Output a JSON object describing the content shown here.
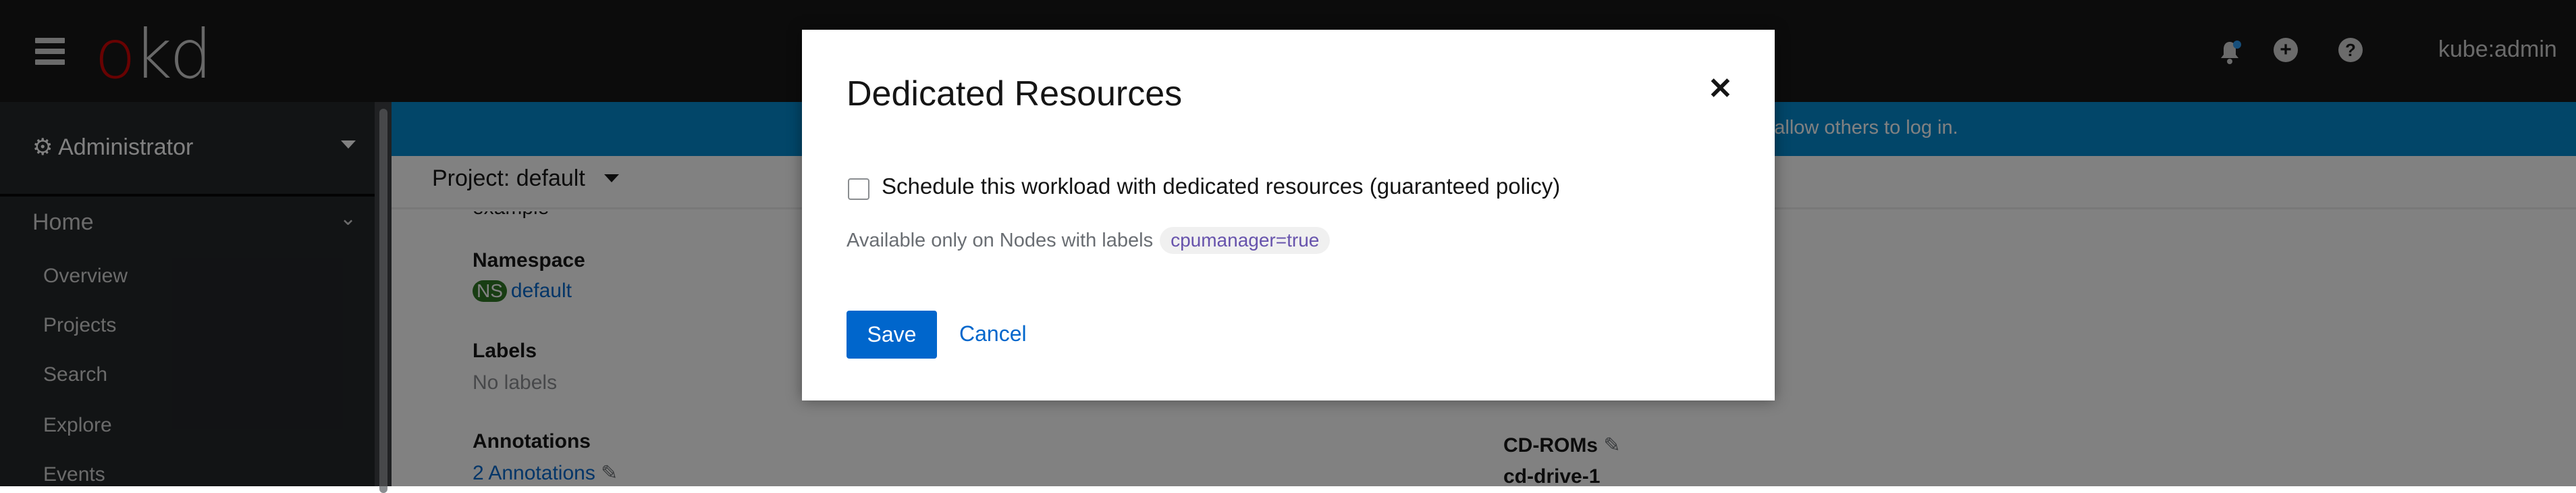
{
  "header": {
    "logo": "okd",
    "user": "kube:admin",
    "icons": [
      "hamburger-icon",
      "bell-icon",
      "plus-circle-icon",
      "question-circle-icon"
    ],
    "notification_color": "#2b9af3"
  },
  "banner": {
    "visible_text": "to allow others to log in."
  },
  "sidebar": {
    "perspective": "Administrator",
    "section": "Home",
    "items": [
      {
        "label": "Overview"
      },
      {
        "label": "Projects"
      },
      {
        "label": "Search"
      },
      {
        "label": "Explore"
      },
      {
        "label": "Events"
      }
    ]
  },
  "project_bar": {
    "label": "Project: default"
  },
  "details": {
    "cut_off_text": "example",
    "namespace_label": "Namespace",
    "namespace_badge": "NS",
    "namespace_value": "default",
    "labels_label": "Labels",
    "labels_value": "No labels",
    "annotations_label": "Annotations",
    "annotations_value": "2 Annotations",
    "cdroms_label": "CD-ROMs",
    "cdrom_value": "cd-drive-1"
  },
  "modal": {
    "title": "Dedicated Resources",
    "checkbox_label": "Schedule this workload with dedicated resources (guaranteed policy)",
    "checkbox_checked": false,
    "help_text": "Available only on Nodes with labels",
    "chip": "cpumanager=true",
    "save": "Save",
    "cancel": "Cancel",
    "primary_color": "#0066cc"
  }
}
